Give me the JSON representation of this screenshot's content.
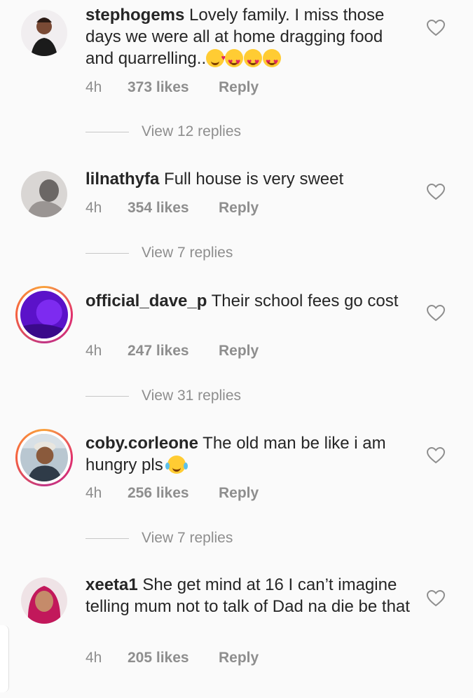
{
  "comments": [
    {
      "username": "stephogems",
      "text": "Lovely family. I miss those days we were all at home dragging food and quarrelling..",
      "time": "4h",
      "likes": "373 likes",
      "reply": "Reply",
      "view_replies": "View 12 replies"
    },
    {
      "username": "lilnathyfa",
      "text": "Full house is very sweet",
      "time": "4h",
      "likes": "354 likes",
      "reply": "Reply",
      "view_replies": "View 7 replies"
    },
    {
      "username": "official_dave_p",
      "text": "Their school fees go cost",
      "time": "4h",
      "likes": "247 likes",
      "reply": "Reply",
      "view_replies": "View 31 replies"
    },
    {
      "username": "coby.corleone",
      "text": "The old man be like i am hungry pls",
      "time": "4h",
      "likes": "256 likes",
      "reply": "Reply",
      "view_replies": "View 7 replies"
    },
    {
      "username": "xeeta1",
      "text": "She get mind at 16 I can’t imagine telling mum not to talk of Dad na die be that",
      "time": "4h",
      "likes": "205 likes",
      "reply": "Reply"
    }
  ],
  "colors": {
    "text": "#262626",
    "meta": "#8e8e8e",
    "background": "#fafafa"
  }
}
